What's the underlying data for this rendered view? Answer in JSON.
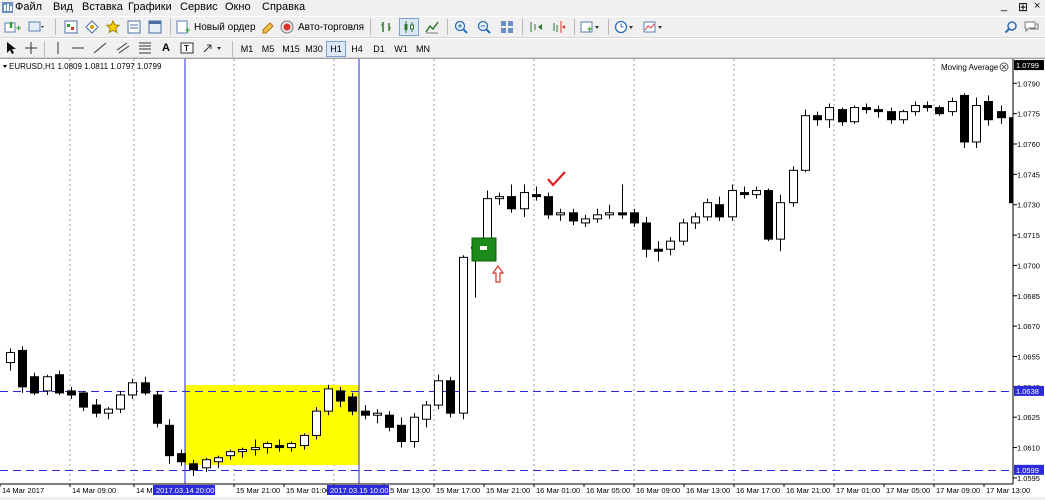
{
  "menu": [
    "Файл",
    "Вид",
    "Вставка",
    "Графики",
    "Сервис",
    "Окно",
    "Справка"
  ],
  "toolbar": {
    "new_order": "Новый ордер",
    "auto_trading": "Авто-торговля",
    "letter_tool": "A",
    "timeframes": [
      "M1",
      "M5",
      "M15",
      "M30",
      "H1",
      "H4",
      "D1",
      "W1",
      "MN"
    ],
    "active_timeframe": "H1"
  },
  "chart": {
    "symbol_info": "EURUSD,H1  1.0809 1.0811 1.0797 1.0799",
    "indicator": "Moving Average",
    "current_price_label": "1.0799",
    "hline_labels": [
      "1.0638",
      "1.0599"
    ],
    "vline_labels": [
      "2017.03.14 20:00",
      "2017.03.15 10:00"
    ],
    "x_labels": [
      "14 Mar 2017",
      "14 Mar 09:00",
      "14 Mar 13:00",
      "",
      "15 Mar 21:00",
      "15 Mar 01:00",
      "15 Mar 05:00",
      "",
      "15 Mar 13:00",
      "15 Mar 17:00",
      "15 Mar 21:00",
      "16 Mar 01:00",
      "16 Mar 05:00",
      "16 Mar 09:00",
      "16 Mar 13:00",
      "16 Mar 17:00",
      "16 Mar 21:00",
      "17 Mar 01:00",
      "17 Mar 05:00",
      "17 Mar 09:00",
      "17 Mar 13:00"
    ]
  },
  "chart_data": {
    "type": "candlestick",
    "symbol": "EURUSD",
    "timeframe": "H1",
    "ylim": [
      1.0592,
      1.0802
    ],
    "yticks": [
      "1.0790",
      "1.0775",
      "1.0760",
      "1.0745",
      "1.0730",
      "1.0715",
      "1.0700",
      "1.0685",
      "1.0670",
      "1.0655",
      "1.0640",
      "1.0625",
      "1.0610",
      "1.0595"
    ],
    "hlines": [
      1.0638,
      1.0599
    ],
    "candles": [
      [
        1.0652,
        1.0659,
        1.0648,
        1.0657
      ],
      [
        1.0658,
        1.066,
        1.0637,
        1.064
      ],
      [
        1.0645,
        1.0647,
        1.0636,
        1.0637
      ],
      [
        1.0638,
        1.0646,
        1.0636,
        1.0645
      ],
      [
        1.0646,
        1.0648,
        1.0636,
        1.0637
      ],
      [
        1.0638,
        1.064,
        1.0634,
        1.0636
      ],
      [
        1.0637,
        1.0638,
        1.0628,
        1.063
      ],
      [
        1.0631,
        1.0634,
        1.0625,
        1.0627
      ],
      [
        1.0627,
        1.063,
        1.0624,
        1.0629
      ],
      [
        1.0629,
        1.0638,
        1.0627,
        1.0636
      ],
      [
        1.0636,
        1.0644,
        1.0634,
        1.0642
      ],
      [
        1.0642,
        1.0645,
        1.0636,
        1.0637
      ],
      [
        1.0636,
        1.0638,
        1.062,
        1.0622
      ],
      [
        1.0621,
        1.0624,
        1.0602,
        1.0606
      ],
      [
        1.0607,
        1.0609,
        1.0601,
        1.0603
      ],
      [
        1.0602,
        1.0604,
        1.0596,
        1.0599
      ],
      [
        1.06,
        1.0605,
        1.0598,
        1.0604
      ],
      [
        1.0603,
        1.0606,
        1.06,
        1.0605
      ],
      [
        1.0606,
        1.0609,
        1.0604,
        1.0608
      ],
      [
        1.0608,
        1.061,
        1.0605,
        1.0609
      ],
      [
        1.0609,
        1.0614,
        1.0606,
        1.061
      ],
      [
        1.061,
        1.0613,
        1.0607,
        1.0612
      ],
      [
        1.0611,
        1.0614,
        1.0608,
        1.061
      ],
      [
        1.061,
        1.0613,
        1.0608,
        1.0612
      ],
      [
        1.0611,
        1.0617,
        1.0609,
        1.0616
      ],
      [
        1.0616,
        1.063,
        1.0614,
        1.0628
      ],
      [
        1.0628,
        1.0641,
        1.0626,
        1.0639
      ],
      [
        1.0638,
        1.064,
        1.063,
        1.0633
      ],
      [
        1.0635,
        1.0637,
        1.0626,
        1.0628
      ],
      [
        1.0628,
        1.0631,
        1.0624,
        1.0626
      ],
      [
        1.0626,
        1.0629,
        1.0622,
        1.0627
      ],
      [
        1.0626,
        1.0628,
        1.0618,
        1.062
      ],
      [
        1.0621,
        1.0625,
        1.061,
        1.0613
      ],
      [
        1.0613,
        1.0627,
        1.061,
        1.0625
      ],
      [
        1.0624,
        1.0633,
        1.062,
        1.0631
      ],
      [
        1.0631,
        1.0646,
        1.0629,
        1.0643
      ],
      [
        1.0643,
        1.0645,
        1.0625,
        1.0627
      ],
      [
        1.0627,
        1.0705,
        1.0624,
        1.0704
      ],
      [
        1.0709,
        1.0711,
        1.0684,
        1.0709
      ],
      [
        1.0707,
        1.0737,
        1.0705,
        1.0733
      ],
      [
        1.0733,
        1.0736,
        1.073,
        1.0734
      ],
      [
        1.0734,
        1.074,
        1.0726,
        1.0728
      ],
      [
        1.0728,
        1.074,
        1.0724,
        1.0736
      ],
      [
        1.0735,
        1.0739,
        1.0732,
        1.0734
      ],
      [
        1.0734,
        1.0736,
        1.0723,
        1.0725
      ],
      [
        1.0725,
        1.0728,
        1.0722,
        1.0726
      ],
      [
        1.0726,
        1.0728,
        1.072,
        1.0722
      ],
      [
        1.0721,
        1.0725,
        1.0719,
        1.0723
      ],
      [
        1.0723,
        1.0728,
        1.0721,
        1.0725
      ],
      [
        1.0725,
        1.073,
        1.0723,
        1.0726
      ],
      [
        1.0726,
        1.074,
        1.0723,
        1.0725
      ],
      [
        1.0726,
        1.0728,
        1.0719,
        1.0721
      ],
      [
        1.0721,
        1.0724,
        1.0704,
        1.0708
      ],
      [
        1.0708,
        1.0712,
        1.0702,
        1.0707
      ],
      [
        1.0708,
        1.0714,
        1.0705,
        1.0712
      ],
      [
        1.0712,
        1.0723,
        1.071,
        1.0721
      ],
      [
        1.0721,
        1.0726,
        1.0718,
        1.0724
      ],
      [
        1.0724,
        1.0733,
        1.0722,
        1.0731
      ],
      [
        1.073,
        1.0734,
        1.0722,
        1.0724
      ],
      [
        1.0724,
        1.074,
        1.0722,
        1.0737
      ],
      [
        1.0736,
        1.0739,
        1.0733,
        1.0735
      ],
      [
        1.0735,
        1.0739,
        1.0733,
        1.0737
      ],
      [
        1.0737,
        1.0738,
        1.0712,
        1.0713
      ],
      [
        1.0713,
        1.0735,
        1.0707,
        1.0731
      ],
      [
        1.0731,
        1.0749,
        1.0729,
        1.0747
      ],
      [
        1.0747,
        1.0777,
        1.0746,
        1.0774
      ],
      [
        1.0774,
        1.0776,
        1.0769,
        1.0772
      ],
      [
        1.0772,
        1.078,
        1.0768,
        1.0778
      ],
      [
        1.0777,
        1.0778,
        1.0769,
        1.0771
      ],
      [
        1.0771,
        1.0779,
        1.077,
        1.0778
      ],
      [
        1.0778,
        1.078,
        1.0775,
        1.0777
      ],
      [
        1.0777,
        1.0779,
        1.0773,
        1.0776
      ],
      [
        1.0776,
        1.0778,
        1.077,
        1.0772
      ],
      [
        1.0772,
        1.0777,
        1.077,
        1.0776
      ],
      [
        1.0776,
        1.0781,
        1.0774,
        1.0779
      ],
      [
        1.0779,
        1.0781,
        1.0776,
        1.0778
      ],
      [
        1.0778,
        1.0779,
        1.0774,
        1.0775
      ],
      [
        1.0776,
        1.0783,
        1.0774,
        1.0781
      ],
      [
        1.0784,
        1.0785,
        1.0758,
        1.0761
      ],
      [
        1.0761,
        1.0783,
        1.0758,
        1.0779
      ],
      [
        1.0781,
        1.0784,
        1.0769,
        1.0772
      ],
      [
        1.0776,
        1.0779,
        1.077,
        1.0773
      ],
      [
        1.0773,
        1.0775,
        1.0728,
        1.0731
      ],
      [
        1.0731,
        1.0737,
        1.0725,
        1.0736
      ],
      [
        1.0736,
        1.0743,
        1.0734,
        1.0741
      ],
      [
        1.0741,
        1.0745,
        1.073,
        1.0732
      ]
    ]
  }
}
